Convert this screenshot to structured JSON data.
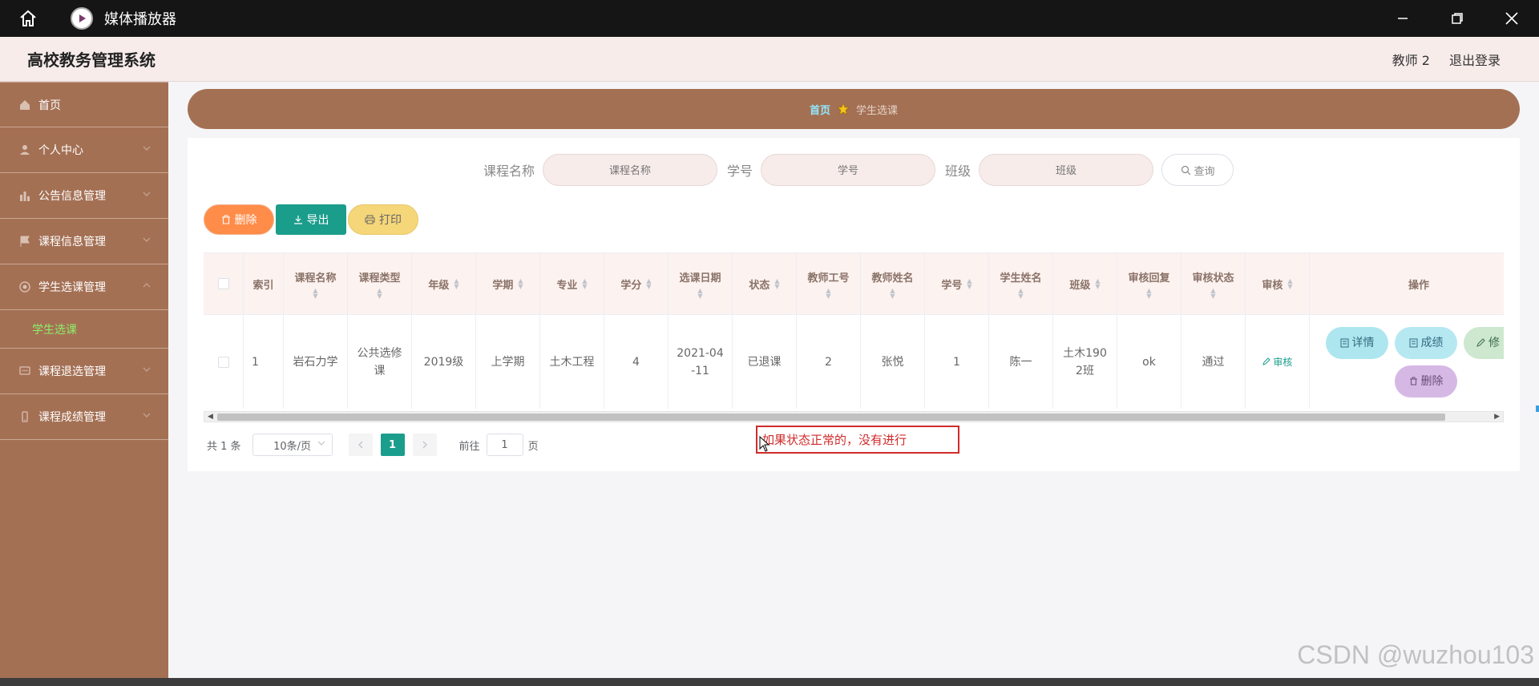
{
  "titlebar": {
    "title": "媒体播放器"
  },
  "header": {
    "brand": "高校教务管理系统",
    "user": "教师 2",
    "logout": "退出登录"
  },
  "sidebar": {
    "items": [
      {
        "label": "首页",
        "icon": "home-icon"
      },
      {
        "label": "个人中心",
        "icon": "user-icon"
      },
      {
        "label": "公告信息管理",
        "icon": "bar-chart-icon"
      },
      {
        "label": "课程信息管理",
        "icon": "flag-icon"
      },
      {
        "label": "学生选课管理",
        "icon": "globe-icon"
      },
      {
        "label": "课程退选管理",
        "icon": "chat-icon"
      },
      {
        "label": "课程成绩管理",
        "icon": "phone-icon"
      }
    ],
    "sub_active": "学生选课"
  },
  "breadcrumb": {
    "home": "首页",
    "current": "学生选课"
  },
  "search": {
    "course_label": "课程名称",
    "course_placeholder": "课程名称",
    "sid_label": "学号",
    "sid_placeholder": "学号",
    "class_label": "班级",
    "class_placeholder": "班级",
    "query": "查询"
  },
  "actions": {
    "delete": "删除",
    "export": "导出",
    "print": "打印"
  },
  "table": {
    "headers": [
      "索引",
      "课程名称",
      "课程类型",
      "年级",
      "学期",
      "专业",
      "学分",
      "选课日期",
      "状态",
      "教师工号",
      "教师姓名",
      "学号",
      "学生姓名",
      "班级",
      "审核回复",
      "审核状态",
      "审核",
      "操作"
    ],
    "row": {
      "index": "1",
      "course": "岩石力学",
      "type": "公共选修课",
      "grade": "2019级",
      "term": "上学期",
      "major": "土木工程",
      "credit": "4",
      "date": "2021-04-11",
      "status": "已退课",
      "tid": "2",
      "tname": "张悦",
      "sid": "1",
      "sname": "陈一",
      "class": "土木1902班",
      "reply": "ok",
      "astatus": "通过",
      "audit": "审核"
    },
    "ops": {
      "detail": "详情",
      "score": "成绩",
      "modify": "修",
      "delete": "删除"
    }
  },
  "pager": {
    "total": "共 1 条",
    "size": "10条/页",
    "page": "1",
    "goto": "前往",
    "goto_value": "1",
    "unit": "页"
  },
  "annotation": "如果状态正常的，没有进行",
  "watermark": "CSDN @wuzhou103"
}
